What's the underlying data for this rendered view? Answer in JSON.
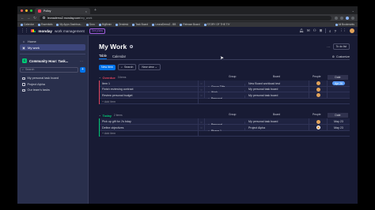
{
  "browser": {
    "tab_title": "Policy",
    "url_domain": "leonademo2.monday.com",
    "url_path": "/my_work",
    "bookmarks": [
      "Calendar",
      "Essentials",
      "My Apps Dashboa...",
      "Duru",
      "BigBrain",
      "Zendesk",
      "Task Board",
      "LeonaDemo2 - BB",
      "Release Board",
      "STORY OF THE TIY"
    ],
    "all_bookmarks": "All Bookmarks"
  },
  "app": {
    "brand": "monday",
    "brand_sub": "work management",
    "plans_label": "See plans"
  },
  "sidebar": {
    "items": [
      {
        "icon": "home-icon",
        "label": "Home"
      },
      {
        "icon": "calendar-icon",
        "label": "My work"
      }
    ],
    "workspace": {
      "badge": "C",
      "name": "Community Hour: Task..."
    },
    "search_placeholder": "Search",
    "add_label": "+",
    "boards": [
      "My personal task board",
      "Project Alpha",
      "Our team's tasks"
    ]
  },
  "main": {
    "title": "My Work",
    "info": "i",
    "more": "···",
    "action_button": "To do list",
    "tabs": [
      "Table",
      "Calendar"
    ],
    "customize_label": "Customize",
    "toolbar": {
      "new_item": "New item",
      "search": "Search",
      "dropdown": "New view"
    },
    "columns": {
      "group": "Group",
      "board": "Board",
      "people": "People",
      "date": "Date"
    },
    "groups": [
      {
        "name": "Overdue",
        "count": "3 items",
        "color": "#e2445c",
        "rows": [
          {
            "name": "Item 1",
            "group": "Group Title",
            "board": "New Board workload test",
            "date": "Apr 26",
            "date_style": "blue"
          },
          {
            "name": "Finish reviewing contract",
            "group": "Work",
            "board": "My personal task board",
            "date": "",
            "date_style": ""
          },
          {
            "name": "Review personal budget",
            "group": "Personal",
            "board": "My personal task board",
            "date": "",
            "date_style": ""
          }
        ],
        "add_label": "+ Add item"
      },
      {
        "name": "Today",
        "count": "2 items",
        "color": "#00c875",
        "rows": [
          {
            "name": "Pick up gift for J's bday",
            "group": "Personal",
            "board": "My personal task board",
            "date": "May 23",
            "date_style": ""
          },
          {
            "name": "Define objectives",
            "group": "Phase 1",
            "board": "Project Alpha",
            "date": "May 23",
            "date_style": ""
          }
        ],
        "add_label": "+ Add item"
      }
    ]
  }
}
